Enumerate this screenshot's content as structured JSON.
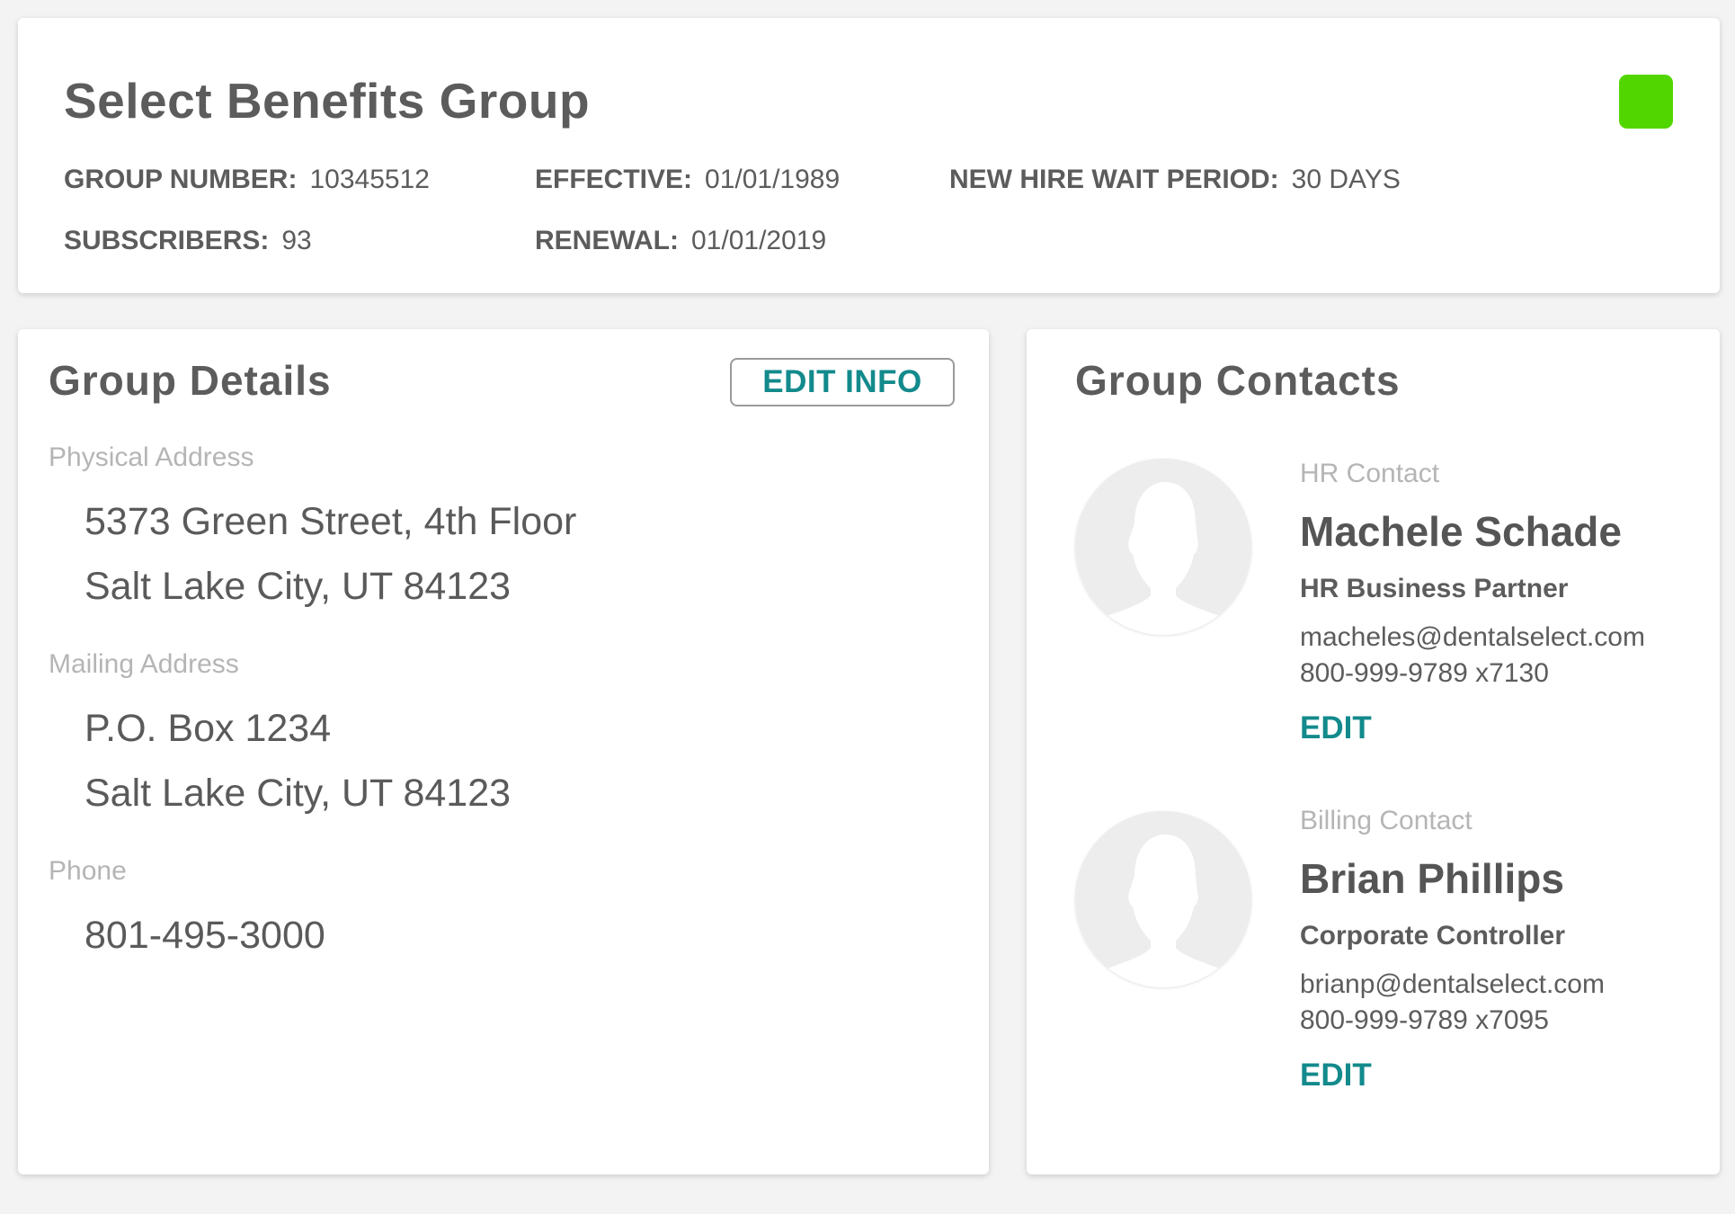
{
  "header": {
    "title": "Select Benefits Group",
    "status_color": "#52d600",
    "fields": {
      "group_number": {
        "label": "GROUP NUMBER:",
        "value": "10345512"
      },
      "effective": {
        "label": "EFFECTIVE:",
        "value": "01/01/1989"
      },
      "new_hire_wait": {
        "label": "NEW HIRE WAIT PERIOD:",
        "value": "30 DAYS"
      },
      "subscribers": {
        "label": "SUBSCRIBERS:",
        "value": "93"
      },
      "renewal": {
        "label": "RENEWAL:",
        "value": "01/01/2019"
      }
    }
  },
  "details": {
    "title": "Group Details",
    "edit_label": "EDIT INFO",
    "physical": {
      "label": "Physical Address",
      "line1": "5373 Green Street, 4th Floor",
      "line2": "Salt Lake City, UT 84123"
    },
    "mailing": {
      "label": "Mailing Address",
      "line1": "P.O. Box 1234",
      "line2": "Salt Lake City, UT 84123"
    },
    "phone": {
      "label": "Phone",
      "value": "801-495-3000"
    }
  },
  "contacts": {
    "title": "Group Contacts",
    "items": [
      {
        "role": "HR Contact",
        "name": "Machele Schade",
        "job_title": "HR Business Partner",
        "email": "macheles@dentalselect.com",
        "phone": "800-999-9789 x7130",
        "edit_label": "EDIT"
      },
      {
        "role": "Billing Contact",
        "name": "Brian Phillips",
        "job_title": "Corporate Controller",
        "email": "brianp@dentalselect.com",
        "phone": "800-999-9789 x7095",
        "edit_label": "EDIT"
      }
    ]
  },
  "colors": {
    "accent": "#138a8c",
    "status": "#52d600",
    "text": "#5c5c5c",
    "muted": "#b5b5b5"
  }
}
